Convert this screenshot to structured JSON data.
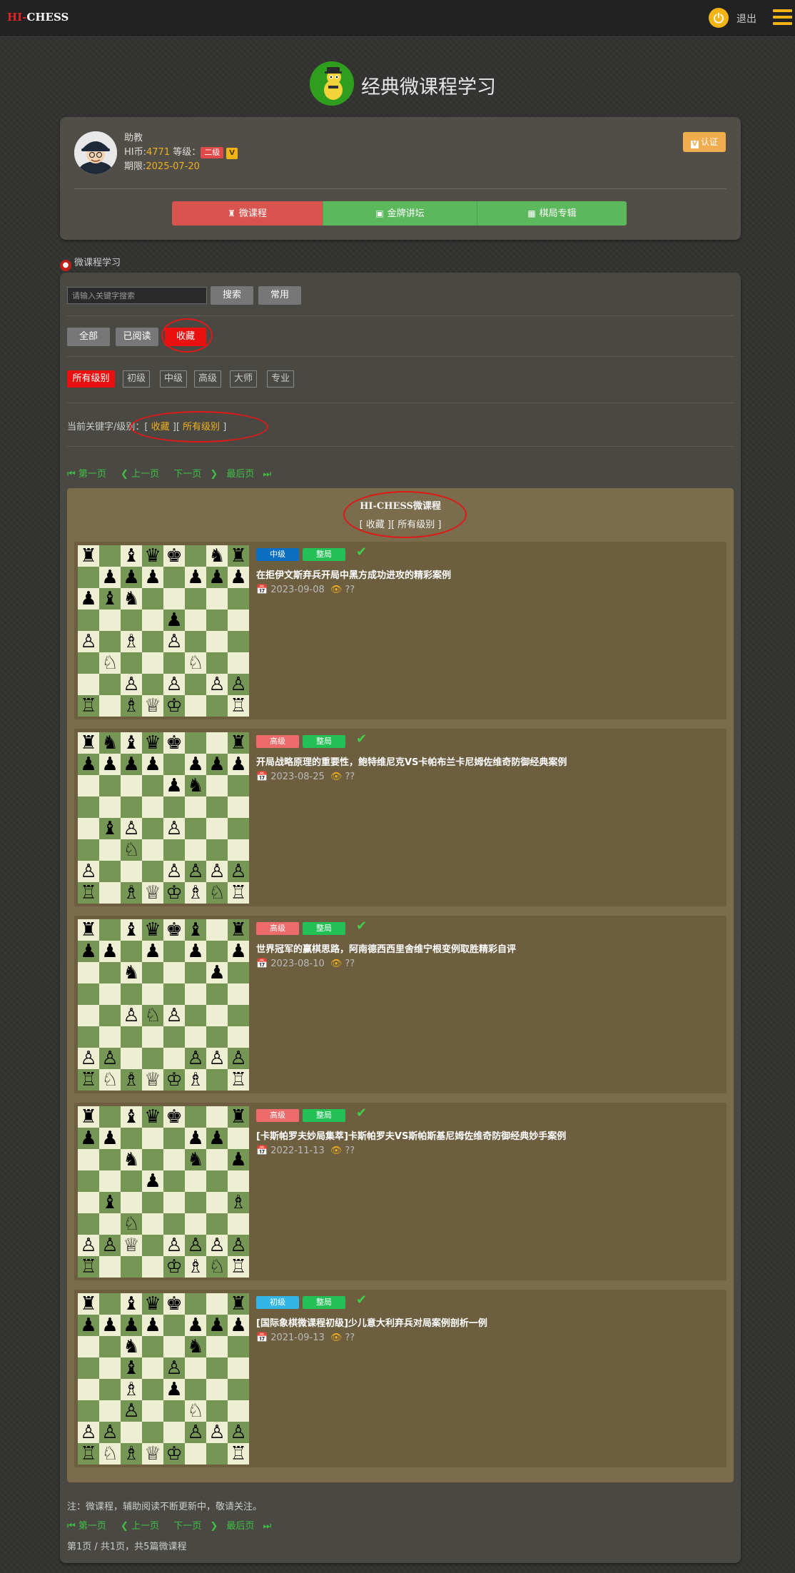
{
  "header": {
    "logo_prefix": "HI-",
    "logo_suffix": "CHESS",
    "logout_label": "退出"
  },
  "page": {
    "title": "经典微课程学习"
  },
  "profile": {
    "role": "助教",
    "coins_label": "HI币:",
    "coins": "4771",
    "level_label": " 等级：",
    "level": "二级",
    "vip_badge": "V",
    "expiry_label": "期限:",
    "expiry": "2025-07-20",
    "cert_button": "认证"
  },
  "tabs": [
    {
      "label": "微课程",
      "icon": "pieces-icon"
    },
    {
      "label": "金牌讲坛",
      "icon": "video-icon"
    },
    {
      "label": "棋局专辑",
      "icon": "board-icon"
    }
  ],
  "section": {
    "label": "微课程学习"
  },
  "search": {
    "placeholder": "请输入关键字搜索",
    "search_button": "搜索",
    "common_button": "常用"
  },
  "filters": [
    "全部",
    "已阅读",
    "收藏"
  ],
  "levels": [
    "所有级别",
    "初级",
    "中级",
    "高级",
    "大师",
    "专业"
  ],
  "keywords": {
    "prefix": "当前关键字/级别：[",
    "keyword": "收藏",
    "mid": "][",
    "level": "所有级别",
    "suffix": "]"
  },
  "pager": {
    "first": "第一页",
    "prev": "上一页",
    "next": "下一页",
    "last": "最后页"
  },
  "list": {
    "heading": "HI-CHESS微课程",
    "subheading": "[ 收藏 ][ 所有级别 ]"
  },
  "colors": {
    "level_beginner": "#33b5e5",
    "level_intermediate": "#0a6fc2",
    "level_advanced": "#ee6b6b",
    "kind": "#22c055",
    "board_light": "#eeeed2",
    "board_dark": "#769656"
  },
  "courses": [
    {
      "level": "中级",
      "level_color": "#0a6fc2",
      "kind": "整局",
      "title": "在拒伊文斯弃兵开局中黑方成功进攻的精彩案例",
      "date": "2023-09-08",
      "views": "??",
      "board": [
        "r.bqk.nr",
        ".ppp.ppp",
        "pbn.....",
        "....p...",
        "P.B.P...",
        ".N...N..",
        "..P.P.PP",
        "R.BQK..R"
      ]
    },
    {
      "level": "高级",
      "level_color": "#ee6b6b",
      "kind": "整局",
      "title": "开局战略原理的重要性，鲍特维尼克VS卡帕布兰卡尼姆佐维奇防御经典案例",
      "date": "2023-08-25",
      "views": "??",
      "board": [
        "rnbqk..r",
        "pppp.ppp",
        "....pn..",
        "........",
        ".bP.P...",
        "..N.....",
        "P...PPPP",
        "R.BQKBNR"
      ]
    },
    {
      "level": "高级",
      "level_color": "#ee6b6b",
      "kind": "整局",
      "title": "世界冠军的赢棋思路，阿南德西西里舍维宁根变例取胜精彩自评",
      "date": "2023-08-10",
      "views": "??",
      "board": [
        "r.bqkb.r",
        "pp.p.p.p",
        "..n...p.",
        "........",
        "..PNP...",
        "........",
        "PP...PPP",
        "RNBQKB.R"
      ]
    },
    {
      "level": "高级",
      "level_color": "#ee6b6b",
      "kind": "整局",
      "title": "[卡斯帕罗夫妙局集萃]卡斯帕罗夫VS斯帕斯基尼姆佐维奇防御经典妙手案例",
      "date": "2022-11-13",
      "views": "??",
      "board": [
        "r.bqk..r",
        "pp...pp.",
        "..n..n.p",
        "...p....",
        ".b.....B",
        "..N.....",
        "PPQ.PPPP",
        "R...KBNR"
      ]
    },
    {
      "level": "初级",
      "level_color": "#33b5e5",
      "kind": "整局",
      "title": "[国际象棋微课程初级]少儿意大利弃兵对局案例剖析一例",
      "date": "2021-09-13",
      "views": "??",
      "board": [
        "r.bqk..r",
        "pppp.ppp",
        "..n..n..",
        "..b.P...",
        "..B.p...",
        "..P..N..",
        "PP...PPP",
        "RNBQK..R"
      ]
    }
  ],
  "footer": {
    "note": "注：微课程，辅助阅读不断更新中，敬请关注。",
    "summary": "第1页 / 共1页，共5篇微课程"
  }
}
